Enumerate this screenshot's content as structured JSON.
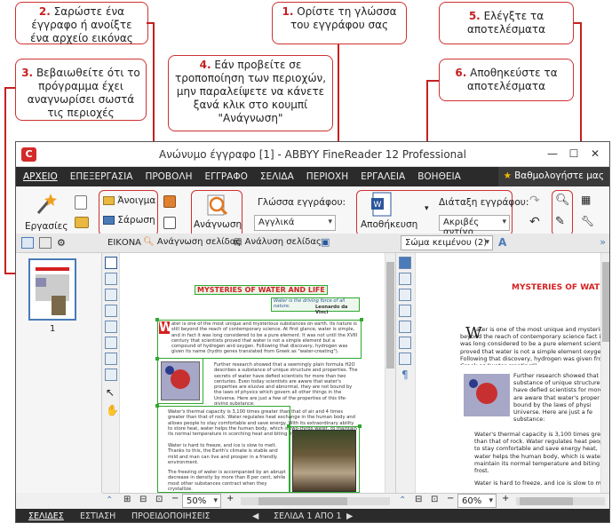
{
  "callouts": {
    "c1": {
      "num": "1.",
      "text": "Ορίστε τη γλώσσα του εγγράφου σας"
    },
    "c2": {
      "num": "2.",
      "text": "Σαρώστε ένα έγγραφο ή ανοίξτε ένα αρχείο εικόνας"
    },
    "c3": {
      "num": "3.",
      "text": "Βεβαιωθείτε ότι το πρόγραμμα έχει αναγνωρίσει σωστά τις περιοχές"
    },
    "c4": {
      "num": "4.",
      "text": "Εάν προβείτε σε τροποποίηση των περιοχών, μην παραλείψετε να κάνετε ξανά κλικ στο κουμπί \"Ανάγνωση\""
    },
    "c5": {
      "num": "5.",
      "text": "Ελέγξτε τα αποτελέσματα"
    },
    "c6": {
      "num": "6.",
      "text": "Αποθηκεύστε τα αποτελέσματα"
    }
  },
  "window": {
    "title": "Ανώνυμο έγγραφο [1] - ABBYY FineReader 12 Professional",
    "minimize": "—",
    "maximize": "☐",
    "close": "✕"
  },
  "menu": [
    "ΑΡΧΕΙΟ",
    "ΕΠΕΞΕΡΓΑΣΙΑ",
    "ΠΡΟΒΟΛΗ",
    "ΕΓΓΡΑΦΟ",
    "ΣΕΛΙΔΑ",
    "ΠΕΡΙΟΧΗ",
    "ΕΡΓΑΛΕΙΑ",
    "ΒΟΗΘΕΙΑ"
  ],
  "rate": "Βαθμολογήστε μας",
  "toolbar": {
    "tasks": "Εργασίες",
    "open": "Άνοιγμα",
    "scan": "Σάρωση",
    "read": "Ανάγνωση",
    "language_label": "Γλώσσα εγγράφου:",
    "language_value": "Αγγλικά",
    "save": "Αποθήκευση",
    "layout_label": "Διάταξη εγγράφου:",
    "layout_value": "Ακριβές αντίγρ"
  },
  "image_bar": {
    "label": "ΕΙΚΟΝΑ",
    "read_page": "Ανάγνωση σελίδας",
    "analyze_page": "Ανάλυση σελίδας"
  },
  "text_bar": {
    "style": "Σώμα κειμένου (2)"
  },
  "thumbnail": {
    "page_number": "1"
  },
  "document": {
    "title": "MYSTERIES OF WATER AND LIFE",
    "quote": "Water is the driving force of all nature.",
    "quote_author": "Leonardo da Vinci",
    "para1": "ater is one of the most unique and mysterious substances on earth. Its nature is still beyond the reach of contemporary science. At first glance, water is simple, and in fact it was long considered to be a pure element. It was not until the XVIII century that scientists proved that water is not a simple element but a compound of hydrogen and oxygen. Following that discovery, hydrogen was given its name (hydro genes translated from Greek as \"water-creating\").",
    "para2": "Further research showed that a seemingly plain formula H2O describes a substance of unique structure and properties. The secrets of water have defied scientists for more than two centuries. Even today scientists are aware that water's properties are elusive and abnormal, they are not bound by the laws of physics which govern all other things in the Universe. Here are just a few of the properties of this life-giving substance:",
    "bullet1": "Water's thermal capacity is 3,100 times greater than that of air and 4 times greater than that of rock. Water regulates heat exchange in the human body and allows people to stay comfortable and save energy. With its extraordinary ability to store heat, water helps the human body, which is two-thirds water, to maintain its normal temperature in scorching heat and biting frost.",
    "bullet2": "Water is hard to freeze, and ice is slow to melt. Thanks to this, the Earth's climate is stable and mild and man can live and prosper in a friendly environment.",
    "bullet3": "The freezing of water is accompanied by an abrupt decrease in density by more than 8 per cent, while most other substances contract when they crystallize."
  },
  "text_view": {
    "title": "MYSTERIES OF WATE",
    "para1": "ater is one of the most unique and mysterious beyond the reach of contemporary science fact it was long considered to be a pure element scientists proved that water is not a simple element oxygen. Following that discovery, hydrogen was given from Greek as \"water-creating\").",
    "para2": "Further research showed that a substance of unique structure have defied scientists for more are aware that water's proper not bound by the laws of physi Universe. Here are just a fe substance:",
    "bullet1": "Water's thermal capacity is 3,100 times greater than that of rock. Water regulates heat people to stay comfortable and save energy heat, water helps the human body, which is water, to maintain its normal temperature and biting frost.",
    "bullet2": "Water is hard to freeze, and ice is slow to m"
  },
  "zoom": {
    "image": "50%",
    "text": "60%"
  },
  "status": {
    "pages": "ΣΕΛΙΔΕΣ",
    "focus": "ΕΣΤΙΑΣΗ",
    "warnings": "ΠΡΟΕΙΔΟΠΟΙΗΣΕΙΣ",
    "page_info": "ΣΕΛΙΔΑ 1 ΑΠΟ 1"
  },
  "colors": {
    "accent_red": "#c62020",
    "logo_red": "#d42a2a",
    "region_green": "#2fa82f",
    "menubar": "#2b2b2b"
  }
}
